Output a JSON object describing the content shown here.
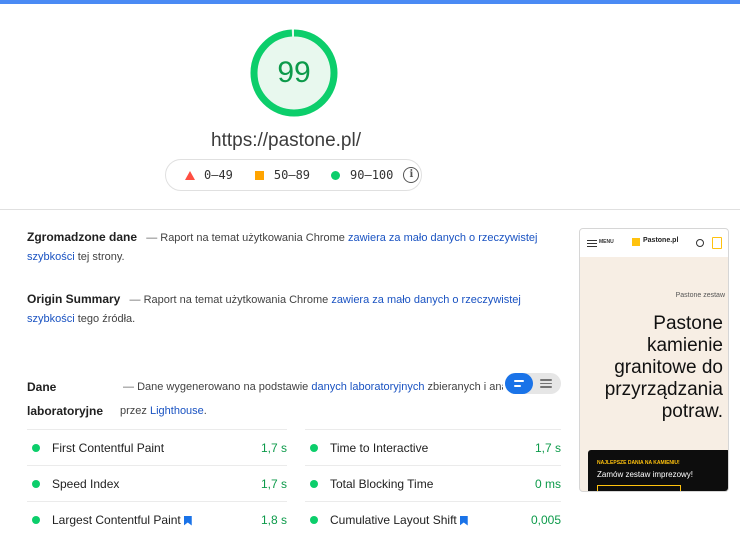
{
  "score": {
    "value": "99",
    "fraction": 0.99,
    "color": "#0cce6b"
  },
  "url": "https://pastone.pl/",
  "legend": [
    {
      "shape": "triangle",
      "color": "#ff4e42",
      "label": "0–49"
    },
    {
      "shape": "square",
      "color": "#ffa400",
      "label": "50–89"
    },
    {
      "shape": "circle",
      "color": "#0cce6b",
      "label": "90–100"
    }
  ],
  "field_data": {
    "title": "Zgromadzone dane",
    "dash": "—",
    "text": "Raport na temat użytkowania Chrome",
    "link": "zawiera za mało danych o rzeczywistej szybkości",
    "suffix": "tej strony."
  },
  "origin_summary": {
    "title": "Origin Summary",
    "dash": "—",
    "text": "Raport na temat użytkowania Chrome",
    "link": "zawiera za mało danych o rzeczywistej szybkości",
    "suffix": "tego źródła."
  },
  "lab_data": {
    "title_line1": "Dane",
    "title_line2": "laboratoryjne",
    "dash": "—",
    "text": "Dane wygenerowano na podstawie",
    "link": "danych laboratoryjnych",
    "suffix": "zbieranych i analizo",
    "line2_prefix": "przez",
    "line2_link": "Lighthouse",
    "line2_suffix": "."
  },
  "metrics": [
    {
      "name": "First Contentful Paint",
      "value": "1,7 s"
    },
    {
      "name": "Time to Interactive",
      "value": "1,7 s"
    },
    {
      "name": "Speed Index",
      "value": "1,7 s"
    },
    {
      "name": "Total Blocking Time",
      "value": "0 ms"
    },
    {
      "name": "Largest Contentful Paint",
      "value": "1,8 s",
      "bookmark": true
    },
    {
      "name": "Cumulative Layout Shift",
      "value": "0,005",
      "bookmark": true
    }
  ],
  "screenshot": {
    "menu": "MENU",
    "logo": "Pastone.pl",
    "subtitle": "Pastone zestaw",
    "heading": "Pastone kamienie granitowe do przyrządzania potraw.",
    "box_small": "NAJLEPSZE DANIA NA KAMIENIU!",
    "box_text": "Zamów zestaw imprezowy!"
  }
}
